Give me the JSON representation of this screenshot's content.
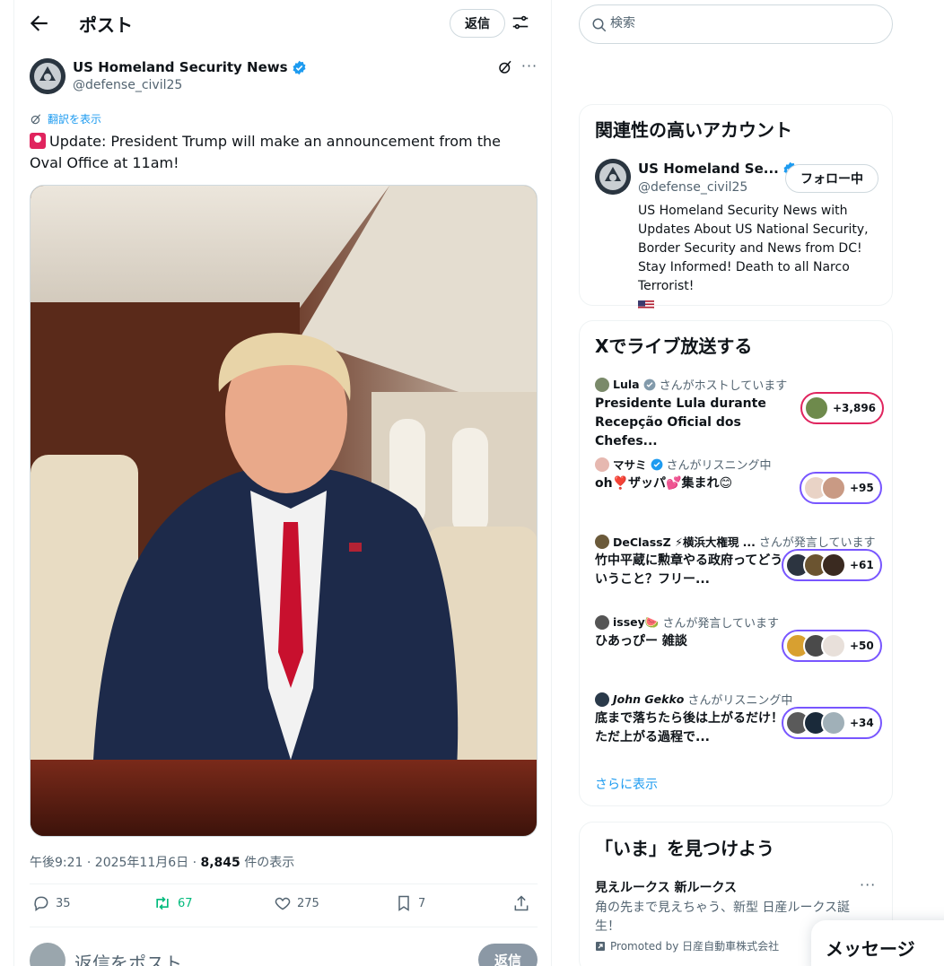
{
  "header": {
    "title": "ポスト",
    "reply_label": "返信"
  },
  "post": {
    "author_name": "US Homeland Security News",
    "author_handle": "@defense_civil25",
    "translate_label": "翻訳を表示",
    "text": "Update: President Trump will make an announcement from the Oval Office at 11am!",
    "meta_time": "午後9:21 · 2025年11月6日 · ",
    "views_count": "8,845",
    "views_label": " 件の表示",
    "stats": {
      "replies": "35",
      "retweets": "67",
      "likes": "275",
      "bookmarks": "7"
    },
    "reply_placeholder": "返信をポスト",
    "reply_submit": "返信"
  },
  "search": {
    "placeholder": "検索"
  },
  "related": {
    "title": "関連性の高いアカウント",
    "name": "US Homeland Se...",
    "handle": "@defense_civil25",
    "follow_label": "フォロー中",
    "bio": "US Homeland Security News with Updates About US National Security, Border Security and News from DC! Stay Informed! Death to all Narco Terrorist!"
  },
  "spaces": {
    "title": "Xでライブ放送する",
    "items": [
      {
        "host": "Lula",
        "status": "さんがホストしています",
        "title": "Presidente Lula durante Recepção Oficial dos Chefes...",
        "count": "+3,896"
      },
      {
        "host": "マサミ",
        "status": "さんがリスニング中",
        "title": "oh❣️ザッパ💕集まれ😊",
        "count": "+95"
      },
      {
        "host": "DeClassZ ⚡横浜大権現 ...",
        "status": "さんが発言しています",
        "title": "竹中平蔵に勲章やる政府ってどういうこと？フリー...",
        "count": "+61"
      },
      {
        "host": "issey🍉",
        "status": "さんが発言しています",
        "title": "ひあっぴー 雑談",
        "count": "+50"
      },
      {
        "host": "𝙅𝙤𝙝𝙣 𝙂𝙚𝙠𝙠𝙤",
        "status": "さんがリスニング中",
        "title": "底まで落ちたら後は上がるだけ！ただ上がる過程で...",
        "count": "+34"
      }
    ],
    "show_more": "さらに表示"
  },
  "trends": {
    "title": "「いま」を見つけよう",
    "item_title": "見えルークス 新ルークス",
    "item_desc": "角の先まで見えちゃう、新型 日産ルークス誕生！",
    "promoted": "Promoted by 日産自動車株式会社"
  },
  "messages": {
    "label": "メッセージ"
  },
  "colors": {
    "accent": "#1d9bf0",
    "retweet": "#00ba7c",
    "live_purple": "#7856ff",
    "live_pink": "#e0245e"
  }
}
